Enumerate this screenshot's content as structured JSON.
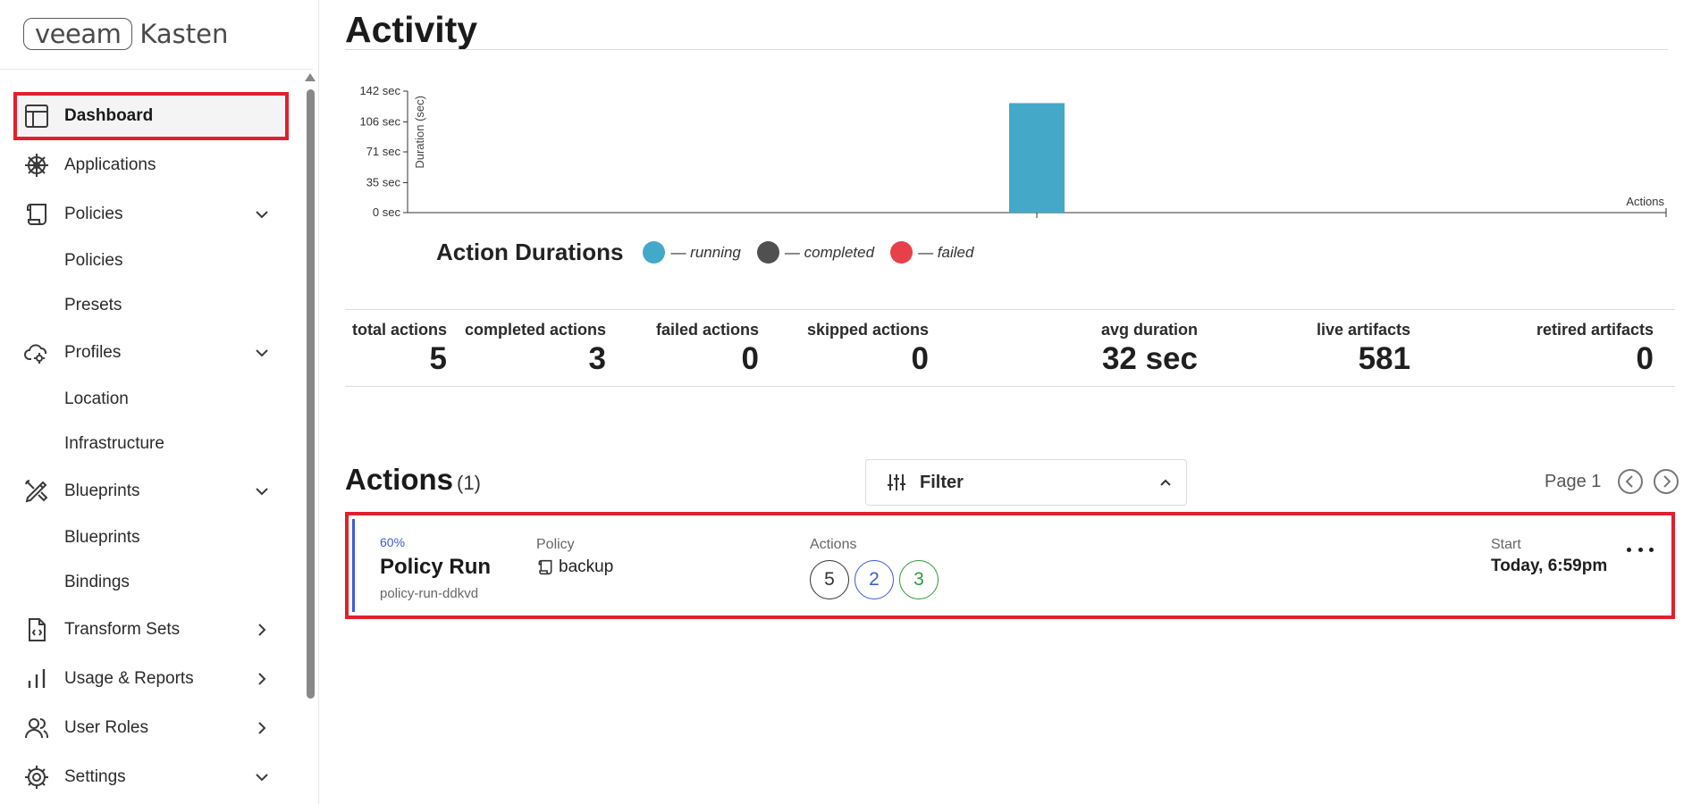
{
  "brand": {
    "part1": "veeam",
    "part2": "Kasten"
  },
  "sidebar": {
    "items": [
      {
        "label": "Dashboard",
        "icon": "dashboard-icon"
      },
      {
        "label": "Applications",
        "icon": "helm-icon"
      },
      {
        "label": "Policies",
        "icon": "scroll-icon",
        "expanded": true,
        "children": [
          "Policies",
          "Presets"
        ]
      },
      {
        "label": "Profiles",
        "icon": "cloud-gear-icon",
        "expanded": true,
        "children": [
          "Location",
          "Infrastructure"
        ]
      },
      {
        "label": "Blueprints",
        "icon": "pencil-ruler-icon",
        "expanded": true,
        "children": [
          "Blueprints",
          "Bindings"
        ]
      },
      {
        "label": "Transform Sets",
        "icon": "file-code-icon",
        "expanded": false
      },
      {
        "label": "Usage & Reports",
        "icon": "bar-chart-icon",
        "expanded": false
      },
      {
        "label": "User Roles",
        "icon": "users-icon",
        "expanded": false
      },
      {
        "label": "Settings",
        "icon": "gear-icon",
        "expanded": true
      }
    ]
  },
  "main": {
    "title": "Activity",
    "chart_legend": {
      "title": "Action Durations",
      "items": [
        {
          "label": "— running",
          "color": "#44a8c8"
        },
        {
          "label": "— completed",
          "color": "#505050"
        },
        {
          "label": "— failed",
          "color": "#e8404a"
        }
      ]
    },
    "stats": [
      {
        "label": "total actions",
        "value": "5"
      },
      {
        "label": "completed actions",
        "value": "3"
      },
      {
        "label": "failed actions",
        "value": "0"
      },
      {
        "label": "skipped actions",
        "value": "0"
      },
      {
        "label": "avg duration",
        "value": "32 sec"
      },
      {
        "label": "live artifacts",
        "value": "581"
      },
      {
        "label": "retired artifacts",
        "value": "0"
      }
    ],
    "actions": {
      "title": "Actions",
      "count": "(1)",
      "filter_label": "Filter",
      "page_label": "Page 1",
      "card": {
        "percent": "60%",
        "name": "Policy Run",
        "id": "policy-run-ddkvd",
        "policy_label": "Policy",
        "policy_value": "backup",
        "actions_label": "Actions",
        "badges": [
          {
            "value": "5",
            "color": "#333333"
          },
          {
            "value": "2",
            "color": "#3c5bd6"
          },
          {
            "value": "3",
            "color": "#2e9a3e"
          }
        ],
        "start_label": "Start",
        "start_value": "Today, 6:59pm"
      }
    }
  },
  "chart_data": {
    "type": "bar",
    "ylabel": "Duration (sec)",
    "xlabel": "Actions",
    "yticks": [
      0,
      35,
      71,
      106,
      142
    ],
    "ytick_labels": [
      "0 sec",
      "35 sec",
      "71 sec",
      "106 sec",
      "142 sec"
    ],
    "ylim": [
      0,
      142
    ],
    "bars": [
      {
        "x": 0.5,
        "value": 128,
        "status": "running",
        "color": "#44a8c8"
      }
    ],
    "xlim": [
      0,
      1
    ],
    "grid": false
  }
}
